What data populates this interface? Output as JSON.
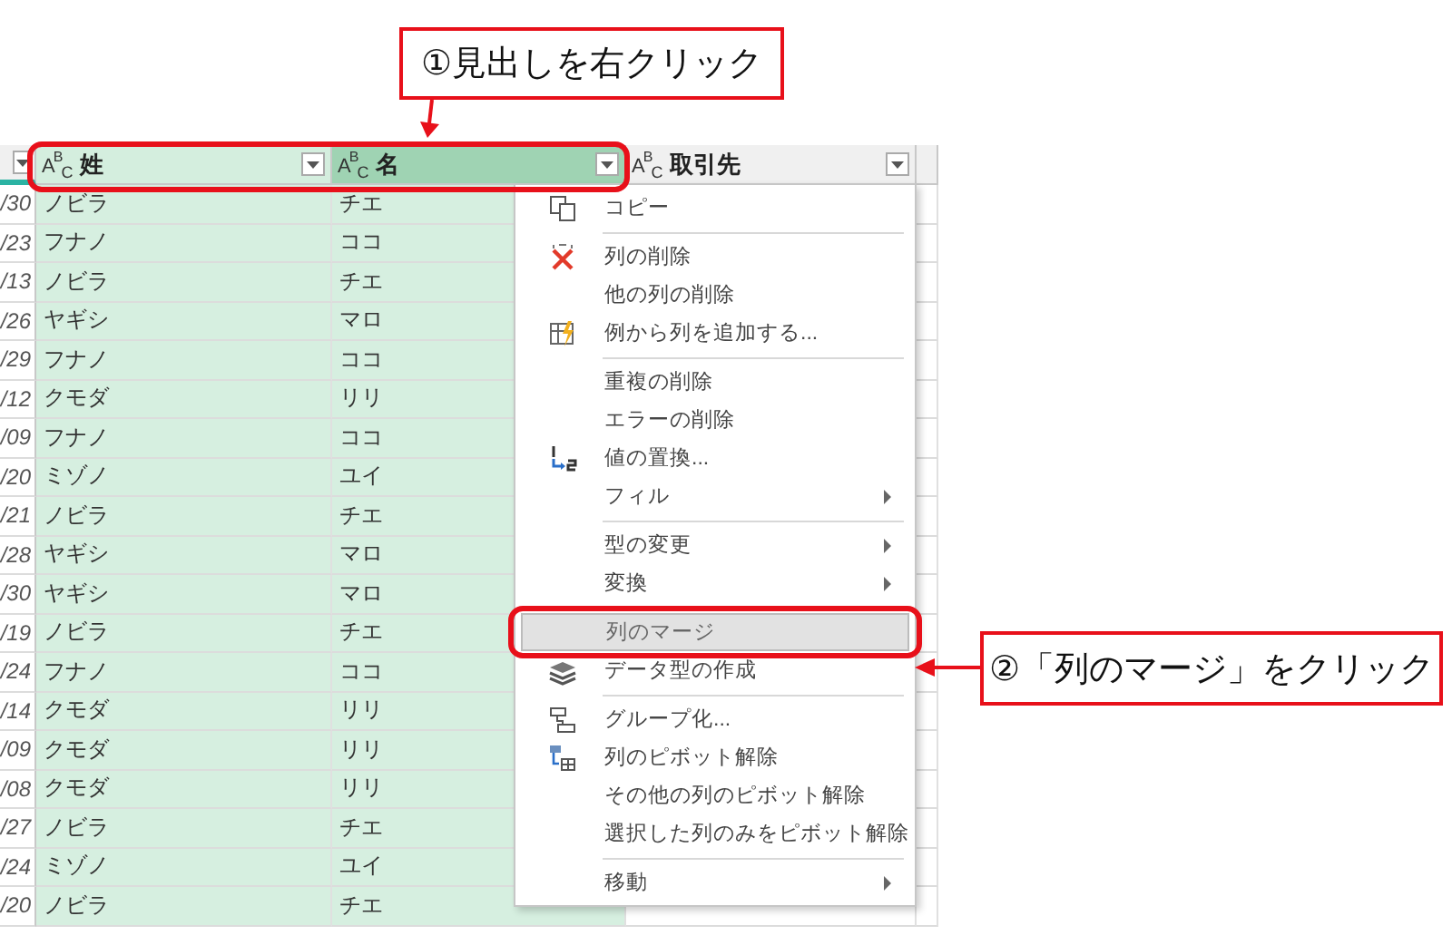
{
  "annotations": [
    {
      "kind": "callout",
      "text": "①見出しを右クリック"
    },
    {
      "kind": "callout",
      "text": "②「列のマージ」をクリック"
    }
  ],
  "table": {
    "columns": [
      {
        "selected": false,
        "focused": false
      },
      {
        "label": "姓",
        "type_label": "A$^{B}$$_{C}$",
        "selected": true,
        "focused": false
      },
      {
        "label": "名",
        "type_label": "A$^{B}$$_{C}$",
        "selected": true,
        "focused": true
      },
      {
        "label": "取引先",
        "type_label": "A$^{B}$$_{C}$",
        "selected": false,
        "focused": false
      }
    ],
    "rows": [
      [
        "/30",
        "ノビラ",
        "チエ"
      ],
      [
        "/23",
        "フナノ",
        "ココ"
      ],
      [
        "/13",
        "ノビラ",
        "チエ"
      ],
      [
        "/26",
        "ヤギシ",
        "マロ"
      ],
      [
        "/29",
        "フナノ",
        "ココ"
      ],
      [
        "/12",
        "クモダ",
        "リリ"
      ],
      [
        "/09",
        "フナノ",
        "ココ"
      ],
      [
        "/20",
        "ミゾノ",
        "ユイ"
      ],
      [
        "/21",
        "ノビラ",
        "チエ"
      ],
      [
        "/28",
        "ヤギシ",
        "マロ"
      ],
      [
        "/30",
        "ヤギシ",
        "マロ"
      ],
      [
        "/19",
        "ノビラ",
        "チエ"
      ],
      [
        "/24",
        "フナノ",
        "ココ"
      ],
      [
        "/14",
        "クモダ",
        "リリ"
      ],
      [
        "/09",
        "クモダ",
        "リリ"
      ],
      [
        "/08",
        "クモダ",
        "リリ"
      ],
      [
        "/27",
        "ノビラ",
        "チエ"
      ],
      [
        "/24",
        "ミゾノ",
        "ユイ"
      ],
      [
        "/20",
        "ノビラ",
        "チエ"
      ]
    ]
  },
  "context_menu": {
    "items": [
      {
        "kind": "item",
        "label": "コピー",
        "submenu": false,
        "selected": false
      },
      {
        "kind": "separator"
      },
      {
        "kind": "item",
        "label": "列の削除",
        "submenu": false,
        "selected": false
      },
      {
        "kind": "item",
        "label": "他の列の削除",
        "submenu": false,
        "selected": false
      },
      {
        "kind": "item",
        "label": "例から列を追加する...",
        "submenu": false,
        "selected": false
      },
      {
        "kind": "separator"
      },
      {
        "kind": "item",
        "label": "重複の削除",
        "submenu": false,
        "selected": false
      },
      {
        "kind": "item",
        "label": "エラーの削除",
        "submenu": false,
        "selected": false
      },
      {
        "kind": "item",
        "label": "値の置換...",
        "submenu": false,
        "selected": false
      },
      {
        "kind": "item",
        "label": "フィル",
        "submenu": true,
        "selected": false
      },
      {
        "kind": "separator"
      },
      {
        "kind": "item",
        "label": "型の変更",
        "submenu": true,
        "selected": false
      },
      {
        "kind": "item",
        "label": "変換",
        "submenu": true,
        "selected": false
      },
      {
        "kind": "separator"
      },
      {
        "kind": "item",
        "label": "列のマージ",
        "submenu": false,
        "selected": true
      },
      {
        "kind": "item",
        "label": "データ型の作成",
        "submenu": false,
        "selected": false
      },
      {
        "kind": "separator"
      },
      {
        "kind": "item",
        "label": "グループ化...",
        "submenu": false,
        "selected": false
      },
      {
        "kind": "item",
        "label": "列のピボット解除",
        "submenu": false,
        "selected": false
      },
      {
        "kind": "item",
        "label": "その他の列のピボット解除",
        "submenu": false,
        "selected": false
      },
      {
        "kind": "item",
        "label": "選択した列のみをピボット解除",
        "submenu": false,
        "selected": false
      },
      {
        "kind": "separator"
      },
      {
        "kind": "item",
        "label": "移動",
        "submenu": true,
        "selected": false
      }
    ]
  }
}
